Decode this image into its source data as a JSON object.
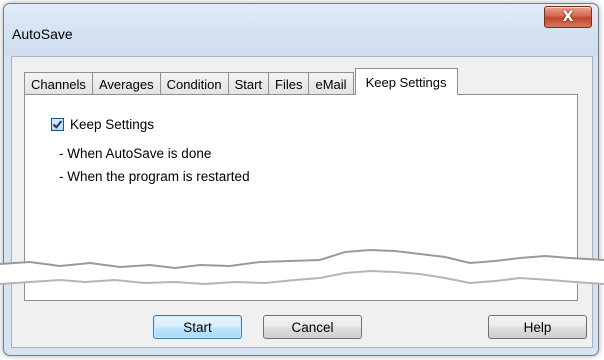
{
  "window": {
    "title": "AutoSave",
    "close_symbol": "X"
  },
  "tabs": [
    {
      "label": "Channels"
    },
    {
      "label": "Averages"
    },
    {
      "label": "Condition"
    },
    {
      "label": "Start"
    },
    {
      "label": "Files"
    },
    {
      "label": "eMail"
    },
    {
      "label": "Keep Settings",
      "active": true
    }
  ],
  "panel": {
    "checkbox": {
      "label": "Keep Settings",
      "checked": true
    },
    "notes": [
      "- When AutoSave is done",
      "- When the program is restarted"
    ]
  },
  "buttons": {
    "start": "Start",
    "cancel": "Cancel",
    "help": "Help"
  },
  "colors": {
    "close_button": "#c2452c",
    "default_button_border": "#3c7fb1",
    "window_frame": "#d6e3f1"
  }
}
